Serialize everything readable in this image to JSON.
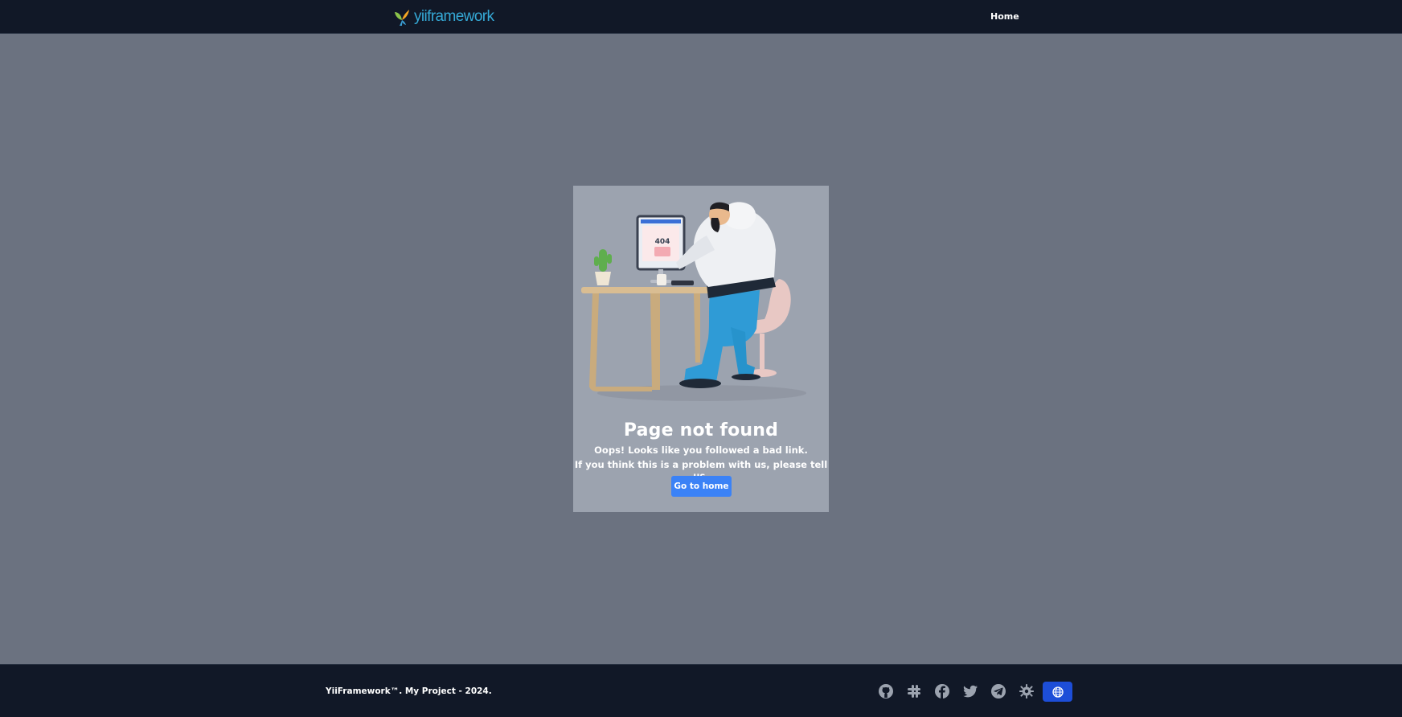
{
  "header": {
    "logo_text": "yiiframework",
    "nav": {
      "home_label": "Home"
    }
  },
  "main": {
    "illustration": {
      "monitor_text": "404"
    },
    "title": "Page not found",
    "message_line1": "Oops! Looks like you followed a bad link.",
    "message_line2": "If you think this is a problem with us, please tell us.",
    "button_label": "Go to home"
  },
  "footer": {
    "copyright": "YiiFramework™. My Project - 2024.",
    "social_icons": [
      "github-icon",
      "slack-icon",
      "facebook-icon",
      "twitter-icon",
      "telegram-icon",
      "yii-forum-icon"
    ],
    "language_icon": "globe-icon"
  },
  "colors": {
    "header_bg": "#111827",
    "page_bg": "#6b7280",
    "card_bg": "#9ca3af",
    "primary_button": "#3b82f6",
    "language_button": "#1d4ed8",
    "logo_text": "#35a9d6"
  }
}
